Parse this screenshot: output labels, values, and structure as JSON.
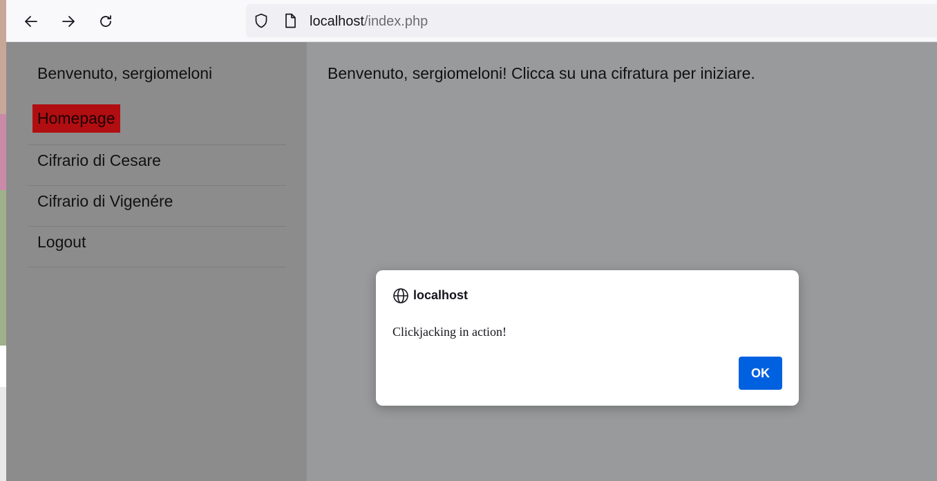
{
  "browser": {
    "url_host": "localhost",
    "url_path": "/index.php"
  },
  "sidebar": {
    "welcome": "Benvenuto, sergiomeloni",
    "items": [
      {
        "label": "Homepage"
      },
      {
        "label": "Cifrario di Cesare"
      },
      {
        "label": "Cifrario di Vigenére"
      },
      {
        "label": "Logout"
      }
    ],
    "active_color": "#b10e12"
  },
  "main": {
    "message": "Benvenuto, sergiomeloni! Clicca su una cifratura per iniziare."
  },
  "dialog": {
    "host": "localhost",
    "message": "Clickjacking in action!",
    "ok_label": "OK",
    "ok_color": "#0061e0"
  }
}
